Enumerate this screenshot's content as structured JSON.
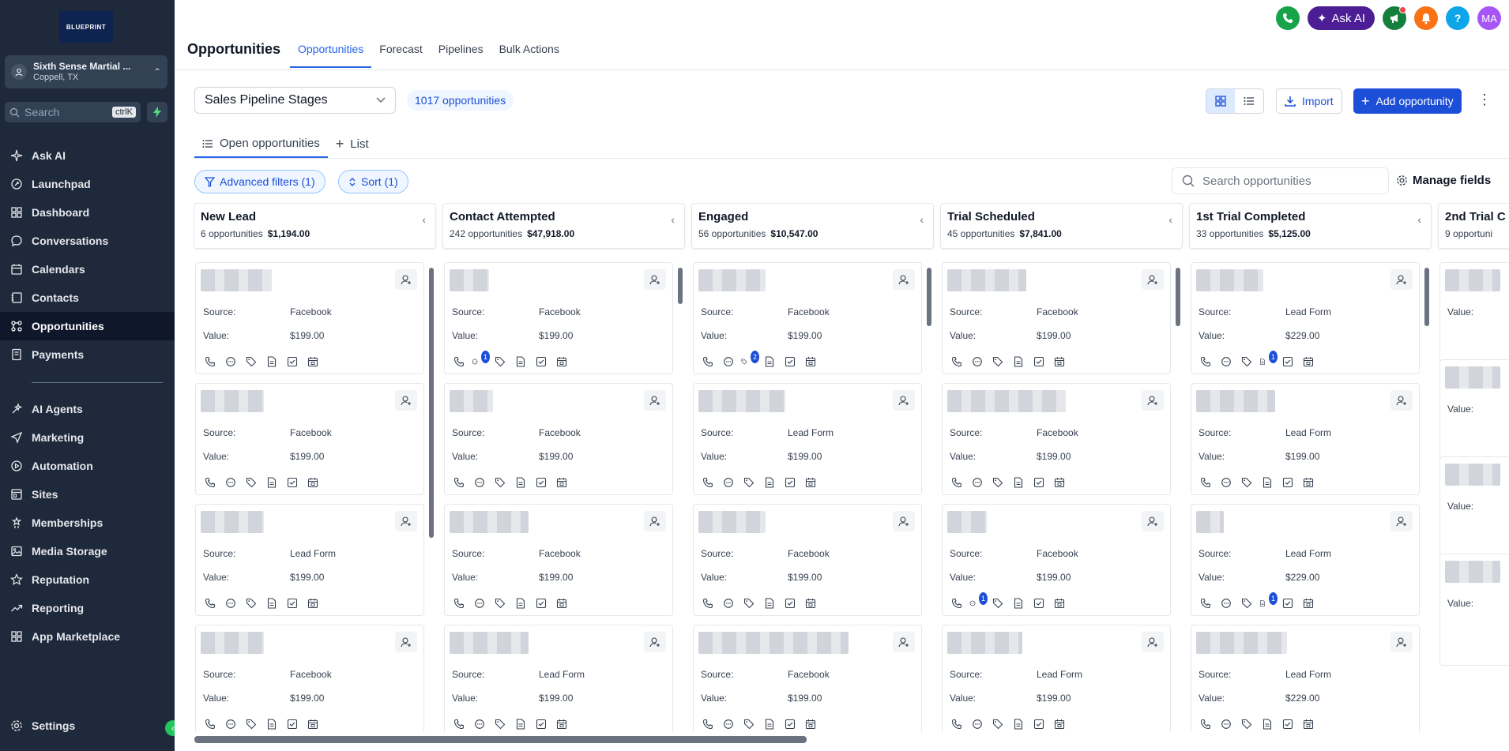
{
  "sidebar": {
    "logo_text": "BLUEPRINT",
    "location": {
      "name": "Sixth Sense Martial ...",
      "city": "Coppell, TX"
    },
    "search": {
      "placeholder": "Search",
      "shortcut": "ctrlK"
    },
    "nav_top": [
      {
        "label": "Ask AI",
        "icon": "sparkle-icon"
      },
      {
        "label": "Launchpad",
        "icon": "rocket-icon"
      },
      {
        "label": "Dashboard",
        "icon": "grid-icon"
      },
      {
        "label": "Conversations",
        "icon": "chat-icon"
      },
      {
        "label": "Calendars",
        "icon": "calendar-icon"
      },
      {
        "label": "Contacts",
        "icon": "contacts-icon"
      },
      {
        "label": "Opportunities",
        "icon": "opportunities-icon",
        "active": true
      },
      {
        "label": "Payments",
        "icon": "payments-icon"
      }
    ],
    "nav_bottom": [
      {
        "label": "AI Agents",
        "icon": "ai-agents-icon"
      },
      {
        "label": "Marketing",
        "icon": "send-icon"
      },
      {
        "label": "Automation",
        "icon": "automation-icon"
      },
      {
        "label": "Sites",
        "icon": "sites-icon"
      },
      {
        "label": "Memberships",
        "icon": "memberships-icon"
      },
      {
        "label": "Media Storage",
        "icon": "image-icon"
      },
      {
        "label": "Reputation",
        "icon": "star-icon"
      },
      {
        "label": "Reporting",
        "icon": "trend-icon"
      },
      {
        "label": "App Marketplace",
        "icon": "apps-icon"
      }
    ],
    "settings_label": "Settings"
  },
  "header": {
    "title": "Opportunities",
    "tabs": [
      "Opportunities",
      "Forecast",
      "Pipelines",
      "Bulk Actions"
    ],
    "ask_ai_label": "Ask AI",
    "avatar_initials": "MA",
    "help_label": "?"
  },
  "toolbar": {
    "pipeline": "Sales Pipeline Stages",
    "count": "1017 opportunities",
    "import_label": "Import",
    "add_label": "Add opportunity"
  },
  "subtabs": {
    "open": "Open opportunities",
    "list": "List"
  },
  "filters": {
    "advanced": "Advanced filters (1)",
    "sort": "Sort (1)",
    "search_placeholder": "Search opportunities",
    "manage_fields": "Manage fields"
  },
  "labels": {
    "source": "Source:",
    "value": "Value:"
  },
  "columns": [
    {
      "title": "New Lead",
      "count": "6 opportunities",
      "amount": "$1,194.00",
      "cards": [
        {
          "source": "Facebook",
          "value": "$199.00",
          "blur": 90
        },
        {
          "source": "Facebook",
          "value": "$199.00",
          "blur": 80
        },
        {
          "source": "Lead Form",
          "value": "$199.00",
          "blur": 80
        },
        {
          "source": "Facebook",
          "value": "$199.00",
          "blur": 80
        }
      ]
    },
    {
      "title": "Contact Attempted",
      "count": "242 opportunities",
      "amount": "$47,918.00",
      "cards": [
        {
          "source": "Facebook",
          "value": "$199.00",
          "blur": 50,
          "badge": [
            1,
            "1"
          ]
        },
        {
          "source": "Facebook",
          "value": "$199.00",
          "blur": 55
        },
        {
          "source": "Facebook",
          "value": "$199.00",
          "blur": 100
        },
        {
          "source": "Lead Form",
          "value": "$199.00",
          "blur": 100
        }
      ]
    },
    {
      "title": "Engaged",
      "count": "56 opportunities",
      "amount": "$10,547.00",
      "cards": [
        {
          "source": "Facebook",
          "value": "$199.00",
          "blur": 85,
          "badge": [
            2,
            "2"
          ]
        },
        {
          "source": "Lead Form",
          "value": "$199.00",
          "blur": 110
        },
        {
          "source": "Facebook",
          "value": "$199.00",
          "blur": 85
        },
        {
          "source": "Facebook",
          "value": "$199.00",
          "blur": 190
        }
      ]
    },
    {
      "title": "Trial Scheduled",
      "count": "45 opportunities",
      "amount": "$7,841.00",
      "cards": [
        {
          "source": "Facebook",
          "value": "$199.00",
          "blur": 100
        },
        {
          "source": "Facebook",
          "value": "$199.00",
          "blur": 150
        },
        {
          "source": "Facebook",
          "value": "$199.00",
          "blur": 50,
          "badge": [
            1,
            "1"
          ]
        },
        {
          "source": "Lead Form",
          "value": "$199.00",
          "blur": 95
        }
      ]
    },
    {
      "title": "1st Trial Completed",
      "count": "33 opportunities",
      "amount": "$5,125.00",
      "cards": [
        {
          "source": "Lead Form",
          "value": "$229.00",
          "blur": 85,
          "badge": [
            3,
            "1"
          ]
        },
        {
          "source": "Lead Form",
          "value": "$199.00",
          "blur": 100
        },
        {
          "source": "Lead Form",
          "value": "$229.00",
          "blur": 35,
          "badge": [
            3,
            "1"
          ]
        },
        {
          "source": "Lead Form",
          "value": "$229.00",
          "blur": 115
        }
      ]
    },
    {
      "title": "2nd Trial C",
      "count": "9 opportuni",
      "amount": "",
      "cards": []
    }
  ],
  "colors": {
    "sidebar": "#1e293b",
    "accent": "#2563eb",
    "phone": "#16a34a",
    "announce": "#15803d",
    "bell": "#f97316",
    "help": "#0ea5e9",
    "avatar": "#a855f7"
  }
}
